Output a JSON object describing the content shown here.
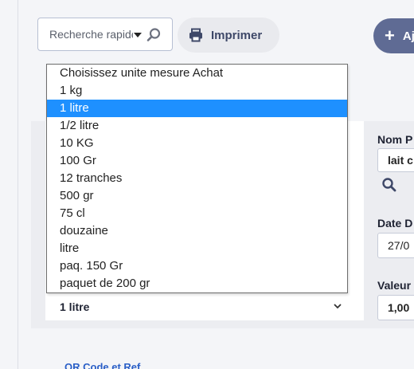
{
  "toolbar": {
    "search_placeholder": "Recherche rapide",
    "print_label": "Imprimer",
    "add_label": "Ajouter"
  },
  "form": {
    "nom_label": "Nom P",
    "nom_value": "lait c",
    "date_label": "Date D",
    "date_value": "27/0",
    "valeur_label": "Valeur",
    "valeur_value": "1,00",
    "unit_select_value": "1 litre",
    "link_text": "QR Code et Ref"
  },
  "dropdown": {
    "options": [
      "Choisissez unite mesure Achat",
      "1 kg",
      "1 litre",
      "1/2 litre",
      "10 KG",
      "100 Gr",
      "12 tranches",
      "500 gr",
      "75 cl",
      "douzaine",
      "litre",
      "paq. 150 Gr",
      "paquet de 200 gr"
    ],
    "selected_index": 2
  },
  "colors": {
    "accent_selected": "#1e90ff",
    "add_button": "#5f6b94",
    "print_button": "#e9eaee"
  }
}
